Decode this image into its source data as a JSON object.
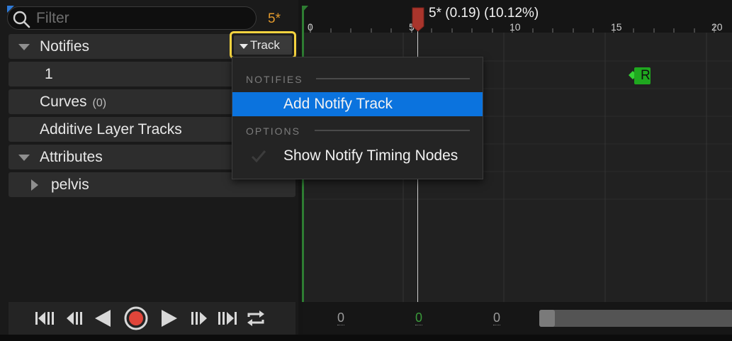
{
  "search": {
    "placeholder": "Filter",
    "frame_count": "5*"
  },
  "tracks": {
    "notifies": {
      "label": "Notifies",
      "track_button": "Track"
    },
    "notify_row": {
      "label": "1"
    },
    "curves": {
      "label": "Curves",
      "count": "(0)"
    },
    "additive": {
      "label": "Additive Layer Tracks"
    },
    "attributes": {
      "label": "Attributes"
    },
    "pelvis": {
      "label": "pelvis"
    }
  },
  "timeline": {
    "scrub_readout": "5* (0.19) (10.12%)",
    "ticks": [
      "0",
      "5",
      "10",
      "15",
      "20"
    ],
    "notify_marker_label": "R",
    "bottom_values": [
      "0",
      "0",
      "0"
    ]
  },
  "menu": {
    "section1": "NOTIFIES",
    "add_notify_track": "Add Notify Track",
    "section2": "OPTIONS",
    "show_timing_nodes": "Show Notify Timing Nodes"
  },
  "transport": {
    "buttons": [
      "skip-to-start",
      "step-back",
      "play-reverse",
      "record",
      "play-forward",
      "step-forward",
      "skip-to-end",
      "loop"
    ]
  },
  "colors": {
    "accent_blue": "#0b73de",
    "highlight_yellow": "#f5d33f",
    "frame_orange": "#e39a2d",
    "record_red": "#e0453a",
    "notify_green": "#1fa81f",
    "scrub_red": "#c0392b"
  }
}
